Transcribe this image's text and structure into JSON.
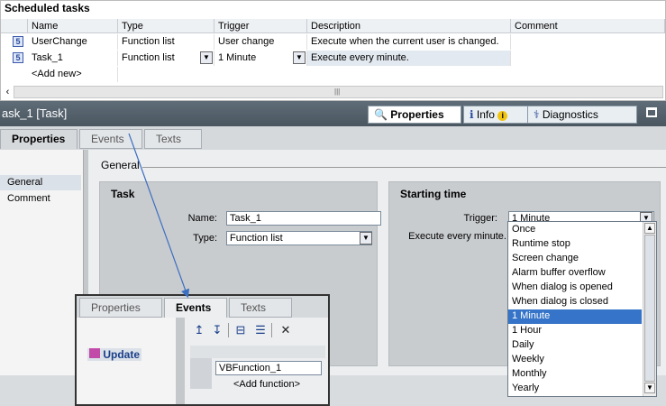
{
  "top": {
    "title": "Scheduled tasks",
    "columns": [
      "Name",
      "Type",
      "Trigger",
      "Description",
      "Comment"
    ],
    "rows": [
      {
        "icon": "5",
        "name": "UserChange",
        "type": "Function list",
        "trigger": "User change",
        "description": "Execute when the current user is changed.",
        "comment": ""
      },
      {
        "icon": "5",
        "name": "Task_1",
        "type": "Function list",
        "trigger": "1 Minute",
        "description": "Execute every minute.",
        "comment": ""
      }
    ],
    "add_new": "<Add new>",
    "scroll_grip": "|||"
  },
  "inspector": {
    "title": "ask_1 [Task]",
    "tabs": [
      {
        "label": "Properties"
      },
      {
        "label": "Info"
      },
      {
        "label": "Diagnostics"
      }
    ],
    "info_badge": "i",
    "prop_tabs": [
      "Properties",
      "Events",
      "Texts"
    ],
    "nav": [
      "General",
      "Comment"
    ],
    "general": "General",
    "task": {
      "heading": "Task",
      "name_label": "Name:",
      "name_value": "Task_1",
      "type_label": "Type:",
      "type_value": "Function list"
    },
    "starting": {
      "heading": "Starting time",
      "trigger_label": "Trigger:",
      "trigger_value": "1 Minute",
      "every_label": "Execute every minute."
    },
    "dropdown_options": [
      "Once",
      "Runtime stop",
      "Screen change",
      "Alarm buffer overflow",
      "When dialog is opened",
      "When dialog is closed",
      "1 Minute",
      "1 Hour",
      "Daily",
      "Weekly",
      "Monthly",
      "Yearly"
    ],
    "dropdown_selected": "1 Minute"
  },
  "inset": {
    "tabs": [
      "Properties",
      "Events",
      "Texts"
    ],
    "event": "Update",
    "functions": [
      "VBFunction_1",
      "<Add function>"
    ]
  },
  "colors": {
    "selection": "#3574c8",
    "header_bar": "#4f5b66"
  }
}
